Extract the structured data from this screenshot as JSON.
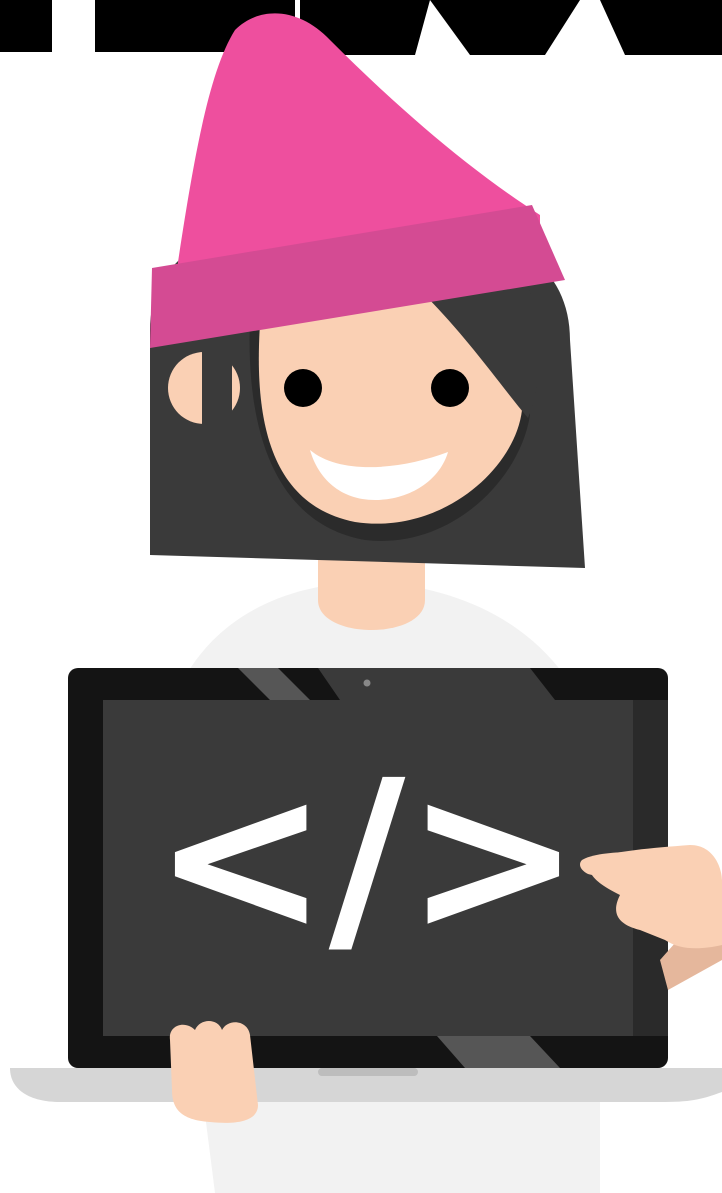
{
  "illustration": {
    "screen_code_symbol": "</>",
    "icon": "html-code-icon",
    "colors": {
      "background": "#ffffff",
      "beanie": "#EE4F9E",
      "beanie_cuff": "#D44B93",
      "hair": "#3A3A3A",
      "skin": "#FAD0B4",
      "skin_shadow": "#E5B79C",
      "shirt": "#F2F2F2",
      "laptop_bezel": "#141414",
      "laptop_screen": "#3A3A3A",
      "laptop_glare": "#565656",
      "laptop_base": "#D6D6D6",
      "code_symbol": "#FFFFFF",
      "eyes": "#000000",
      "mouth": "#FFFFFF"
    }
  }
}
